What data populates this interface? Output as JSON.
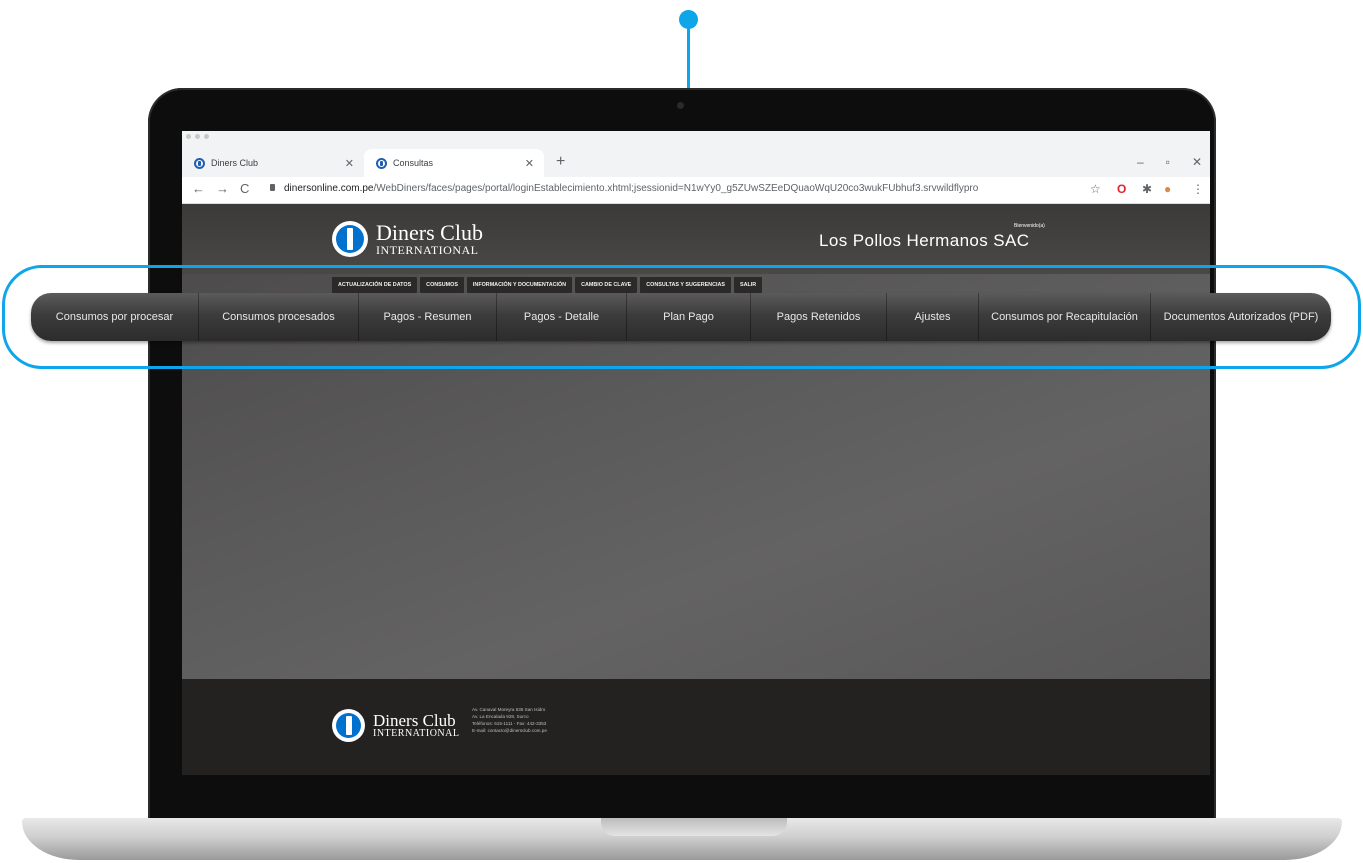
{
  "browser": {
    "tabs": [
      {
        "label": "Diners Club"
      },
      {
        "label": "Consultas"
      }
    ],
    "url_host": "dinersonline.com.pe",
    "url_path": "/WebDiners/faces/pages/portal/loginEstablecimiento.xhtml;jsessionid=N1wYy0_g5ZUwSZEeDQuaoWqU20co3wukFUbhuf3.srvwildflypro"
  },
  "header": {
    "logo_line1": "Diners Club",
    "logo_line2": "INTERNATIONAL",
    "welcome": "Bienvenido(a)",
    "company": "Los Pollos Hermanos SAC"
  },
  "top_menu": [
    "ACTUALIZACIÓN DE DATOS",
    "CONSUMOS",
    "INFORMACIÓN Y DOCUMENTACIÓN",
    "CAMBIO DE CLAVE",
    "CONSULTAS Y SUGERENCIAS",
    "SALIR"
  ],
  "sub_menu": [
    "Consumos por procesar",
    "Consumos procesados",
    "Pagos - Resumen",
    "Pagos - Detalle",
    "Plan Pago",
    "Pagos Retenidos",
    "Ajustes",
    "Consumos por Recapitulación",
    "Documentos Autorizados (PDF)"
  ],
  "footer": {
    "logo_line1": "Diners Club",
    "logo_line2": "INTERNATIONAL",
    "address_lines": [
      "Av. Canaval Moreyra 535 San Isidro",
      "Av. La Encalada 928, Surco",
      "Teléfonos: 615-1111 - Fax: 442-3353",
      "E-mail: contacto@dinersclub.com.pe"
    ]
  },
  "colors": {
    "accent": "#0ea5e9",
    "brand_blue": "#0072ce"
  }
}
